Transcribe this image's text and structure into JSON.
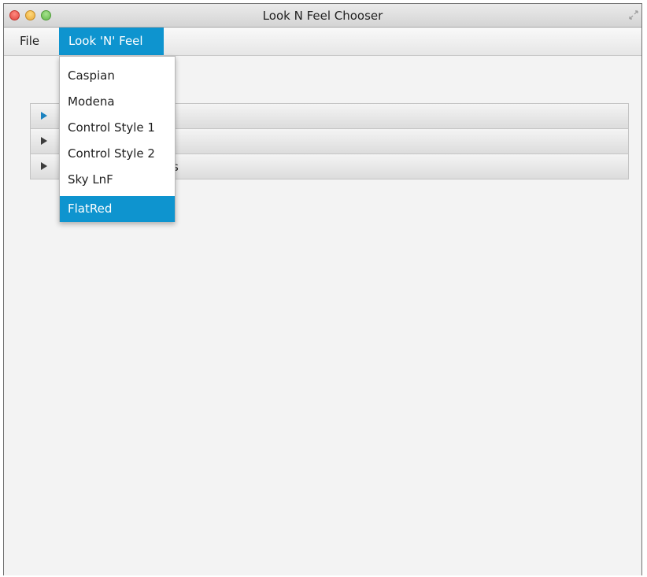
{
  "window": {
    "title": "Look N Feel Chooser"
  },
  "menubar": {
    "items": [
      {
        "label": "File"
      },
      {
        "label": "Look 'N' Feel",
        "open": true
      }
    ]
  },
  "dropdown": {
    "items": [
      {
        "label": "Caspian"
      },
      {
        "label": "Modena"
      },
      {
        "label": "Control Style 1"
      },
      {
        "label": "Control Style 2"
      },
      {
        "label": "Sky LnF"
      },
      {
        "label": "FlatRed",
        "highlighted": true
      }
    ]
  },
  "accordion": {
    "panes": [
      {
        "visible_title": "",
        "focused": true
      },
      {
        "visible_title": ""
      },
      {
        "visible_title": "s"
      }
    ]
  },
  "colors": {
    "accent": "#0e94cf",
    "window_background": "#f3f3f3",
    "close": "#e0443e",
    "minimize": "#e9a93a",
    "maximize": "#63b94a"
  },
  "icons": {
    "resize": "fullscreen-arrows-icon",
    "pane_arrow": "triangle-right-icon"
  }
}
